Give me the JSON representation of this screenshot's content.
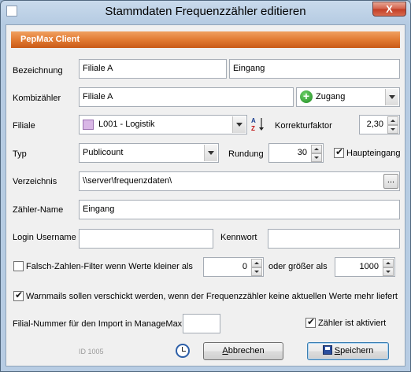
{
  "window": {
    "title": "Stammdaten Frequenzzähler editieren",
    "close_symbol": "X"
  },
  "banner": {
    "title": "PepMax Client"
  },
  "bezeichnung": {
    "label": "Bezeichnung",
    "value1": "Filiale A",
    "value2": "Eingang"
  },
  "kombizaehler": {
    "label": "Kombizähler",
    "value": "Filiale A",
    "type_value": "Zugang",
    "type_icon": "plus-circle-icon",
    "plus_symbol": "+"
  },
  "filiale": {
    "label": "Filiale",
    "value": "L001 - Logistik",
    "sort_icon": "sort-az-icon",
    "sort_a": "A",
    "sort_z": "Z"
  },
  "korrekturfaktor": {
    "label": "Korrekturfaktor",
    "value": "2,30"
  },
  "typ": {
    "label": "Typ",
    "value": "Publicount"
  },
  "rundung": {
    "label": "Rundung",
    "value": "30"
  },
  "haupteingang": {
    "label": "Haupteingang",
    "checked": true
  },
  "verzeichnis": {
    "label": "Verzeichnis",
    "value": "\\\\server\\frequenzdaten\\",
    "browse_label": "..."
  },
  "zaehler_name": {
    "label": "Zähler-Name",
    "value": "Eingang"
  },
  "login": {
    "label": "Login Username",
    "value": ""
  },
  "kennwort": {
    "label": "Kennwort",
    "value": ""
  },
  "falsch_filter": {
    "label": "Falsch-Zahlen-Filter wenn Werte kleiner als",
    "checked": false,
    "min_value": "0",
    "or_label": "oder größer als",
    "max_value": "1000"
  },
  "warnmails": {
    "label": "Warnmails sollen verschickt werden, wenn der Frequenzzähler keine aktuellen Werte mehr liefert",
    "checked": true
  },
  "filial_nummer": {
    "label": "Filial-Nummer für den Import in ManageMax",
    "value": ""
  },
  "zaehler_aktiv": {
    "label": "Zähler ist aktiviert",
    "checked": true
  },
  "footer": {
    "id_text": "ID 1005",
    "clock_icon": "clock-icon",
    "cancel_label": "Abbrechen",
    "cancel_mnemonic": "A",
    "cancel_rest": "bbrechen",
    "save_label": "Speichern",
    "save_mnemonic": "S",
    "save_rest": "peichern",
    "save_icon": "floppy-disk-icon"
  },
  "colors": {
    "banner": "#e07830",
    "titlebar": "#c9daec",
    "swatch": "#d9b6e6"
  }
}
